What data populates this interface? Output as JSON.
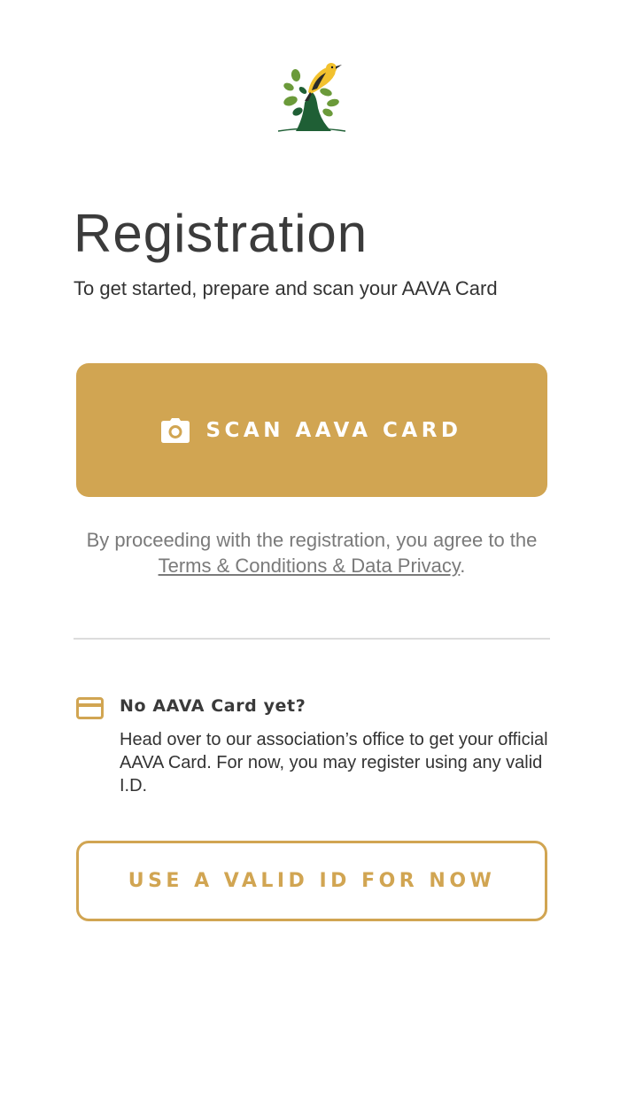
{
  "logo": {
    "icon": "bird-on-tree-logo",
    "bird_color": "#f2c12e",
    "leaf_color": "#6b9a3a",
    "trunk_color": "#1f5f35"
  },
  "header": {
    "title": "Registration",
    "subtitle": "To get started, prepare and scan your AAVA Card"
  },
  "scan_button": {
    "icon": "camera-icon",
    "label": "SCAN AAVA CARD"
  },
  "terms": {
    "prefix": "By proceeding with the registration, you agree to the ",
    "link_label": "Terms & Conditions & Data Privacy",
    "suffix": "."
  },
  "no_card": {
    "icon": "credit-card-icon",
    "title": "No AAVA Card yet?",
    "description": "Head over to our association’s office to get your official AAVA Card. For now, you may register using any valid I.D."
  },
  "valid_id_button": {
    "label": "USE A VALID ID FOR NOW"
  },
  "colors": {
    "accent": "#d1a552",
    "text": "#3b3b3b",
    "muted": "#7a7a7a",
    "divider": "#dcdcdc"
  }
}
